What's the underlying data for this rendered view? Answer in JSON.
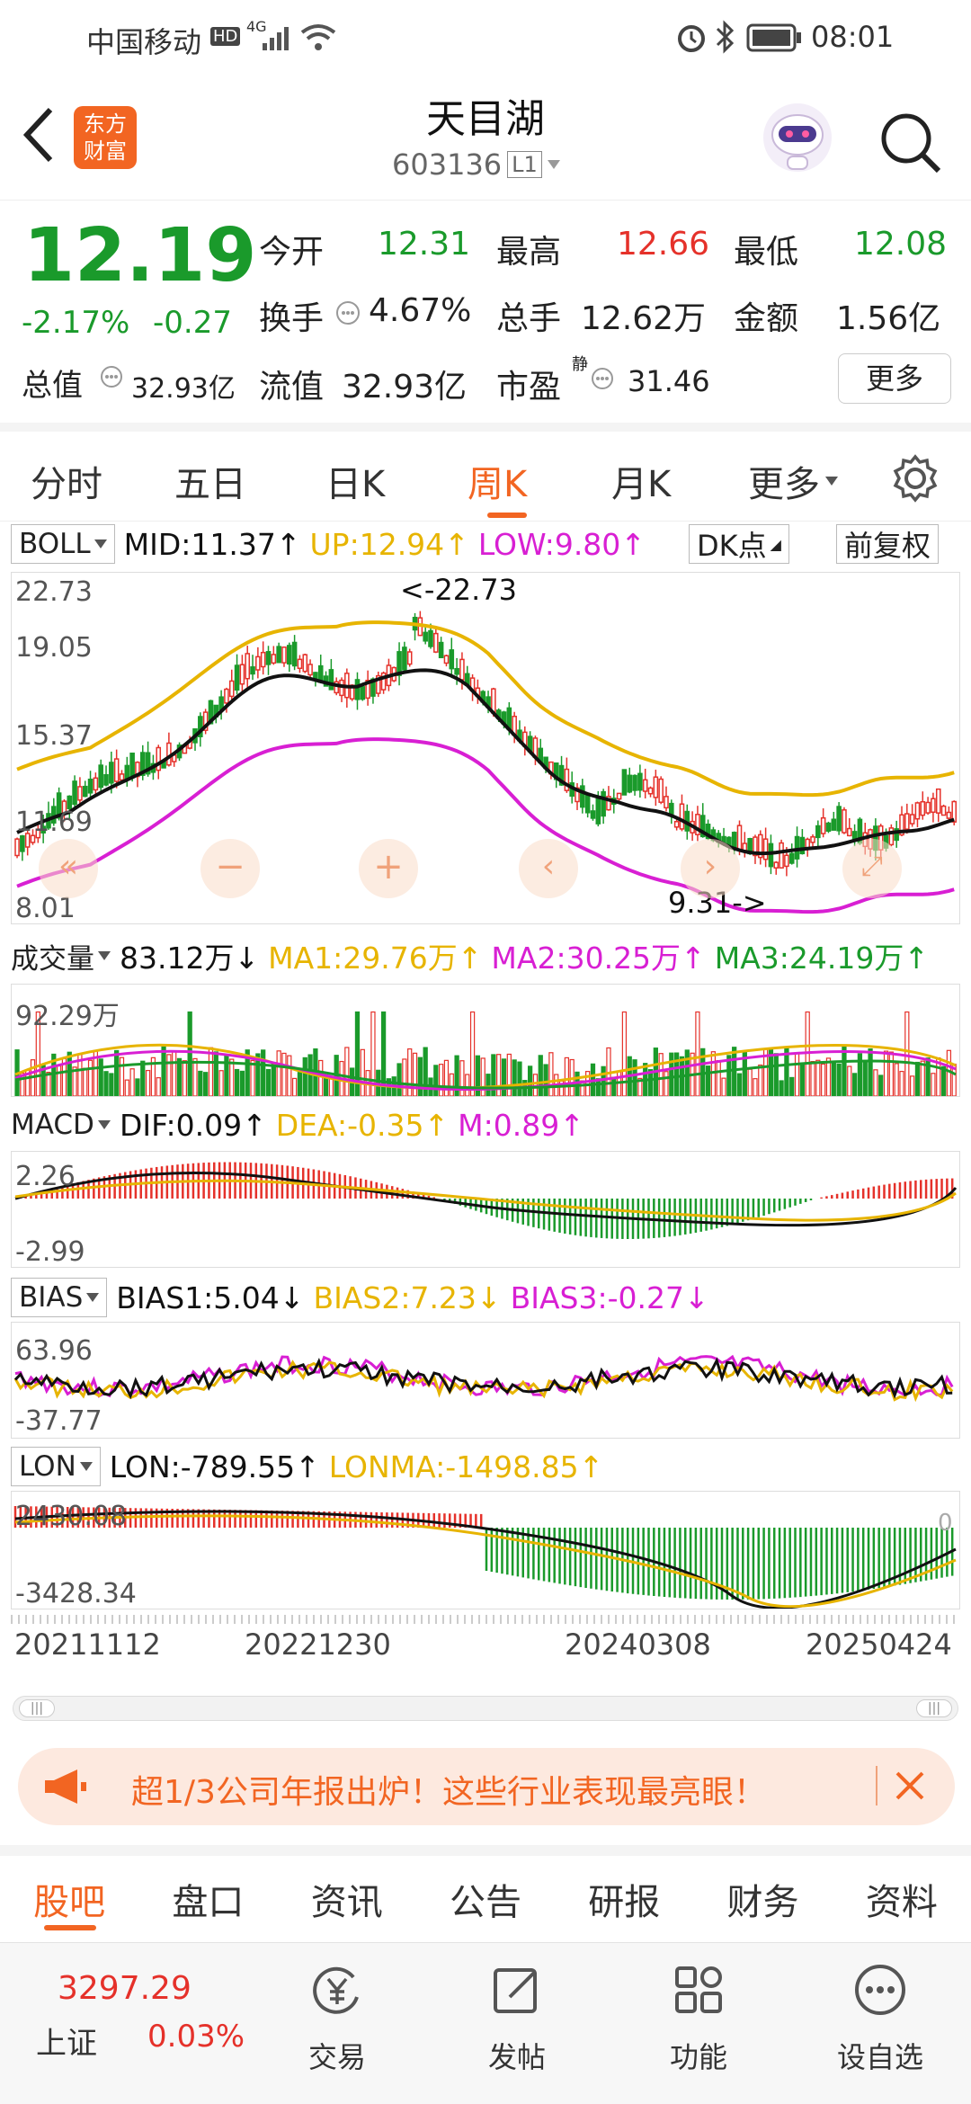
{
  "status_bar": {
    "carrier": "中国移动",
    "hd": "HD",
    "network": "4G",
    "time": "08:01"
  },
  "header": {
    "logo_line1": "东方",
    "logo_line2": "财富",
    "stock_name": "天目湖",
    "stock_code": "603136",
    "level": "L1"
  },
  "quote": {
    "price": "12.19",
    "change_pct": "-2.17%",
    "change": "-0.27",
    "open_label": "今开",
    "open": "12.31",
    "high_label": "最高",
    "high": "12.66",
    "low_label": "最低",
    "low": "12.08",
    "turnover_label": "换手",
    "turnover": "4.67%",
    "volume_label": "总手",
    "volume": "12.62万",
    "amount_label": "金额",
    "amount": "1.56亿",
    "mktcap_label": "总值",
    "mktcap": "32.93亿",
    "float_label": "流值",
    "float": "32.93亿",
    "pe_label": "市盈",
    "pe_sup": "静",
    "pe": "31.46",
    "more_button": "更多"
  },
  "period_tabs": {
    "items": [
      "分时",
      "五日",
      "日K",
      "周K",
      "月K",
      "更多"
    ],
    "active": "周K"
  },
  "boll": {
    "name": "BOLL",
    "mid": "MID:11.37↑",
    "up": "UP:12.94↑",
    "low": "LOW:9.80↑",
    "dk": "DK点",
    "adjust": "前复权",
    "y_labels": [
      "22.73",
      "19.05",
      "15.37",
      "11.69",
      "8.01"
    ],
    "max_marker": "<-22.73",
    "min_marker": "9.31->"
  },
  "volume": {
    "name": "成交量",
    "value": "83.12万↓",
    "ma1": "MA1:29.76万↑",
    "ma2": "MA2:30.25万↑",
    "ma3": "MA3:24.19万↑",
    "y_label": "92.29万"
  },
  "macd": {
    "name": "MACD",
    "dif": "DIF:0.09↑",
    "dea": "DEA:-0.35↑",
    "m": "M:0.89↑",
    "y_top": "2.26",
    "y_bottom": "-2.99"
  },
  "bias": {
    "name": "BIAS",
    "b1": "BIAS1:5.04↓",
    "b2": "BIAS2:7.23↓",
    "b3": "BIAS3:-0.27↓",
    "y_top": "63.96",
    "y_bottom": "-37.77"
  },
  "lon": {
    "name": "LON",
    "lon": "LON:-789.55↑",
    "lonma": "LONMA:-1498.85↑",
    "y_top": "2430.08",
    "y_bottom": "-3428.34",
    "zero": "0"
  },
  "dates": [
    "20211112",
    "20221230",
    "20240308",
    "20250424"
  ],
  "banner": {
    "text": "超1/3公司年报出炉！这些行业表现最亮眼！"
  },
  "bottom_tabs": {
    "items": [
      "股吧",
      "盘口",
      "资讯",
      "公告",
      "研报",
      "财务",
      "资料"
    ],
    "active": "股吧"
  },
  "bottom_nav": {
    "index_value": "3297.29",
    "index_name": "上证",
    "index_change": "0.03%",
    "items": [
      "交易",
      "发帖",
      "功能",
      "设自选"
    ]
  },
  "colors": {
    "up": "#e5312a",
    "down": "#1a9a2b",
    "accent": "#f26522",
    "mid": "#111111",
    "upper": "#e7b400",
    "lower": "#d81fd3"
  }
}
